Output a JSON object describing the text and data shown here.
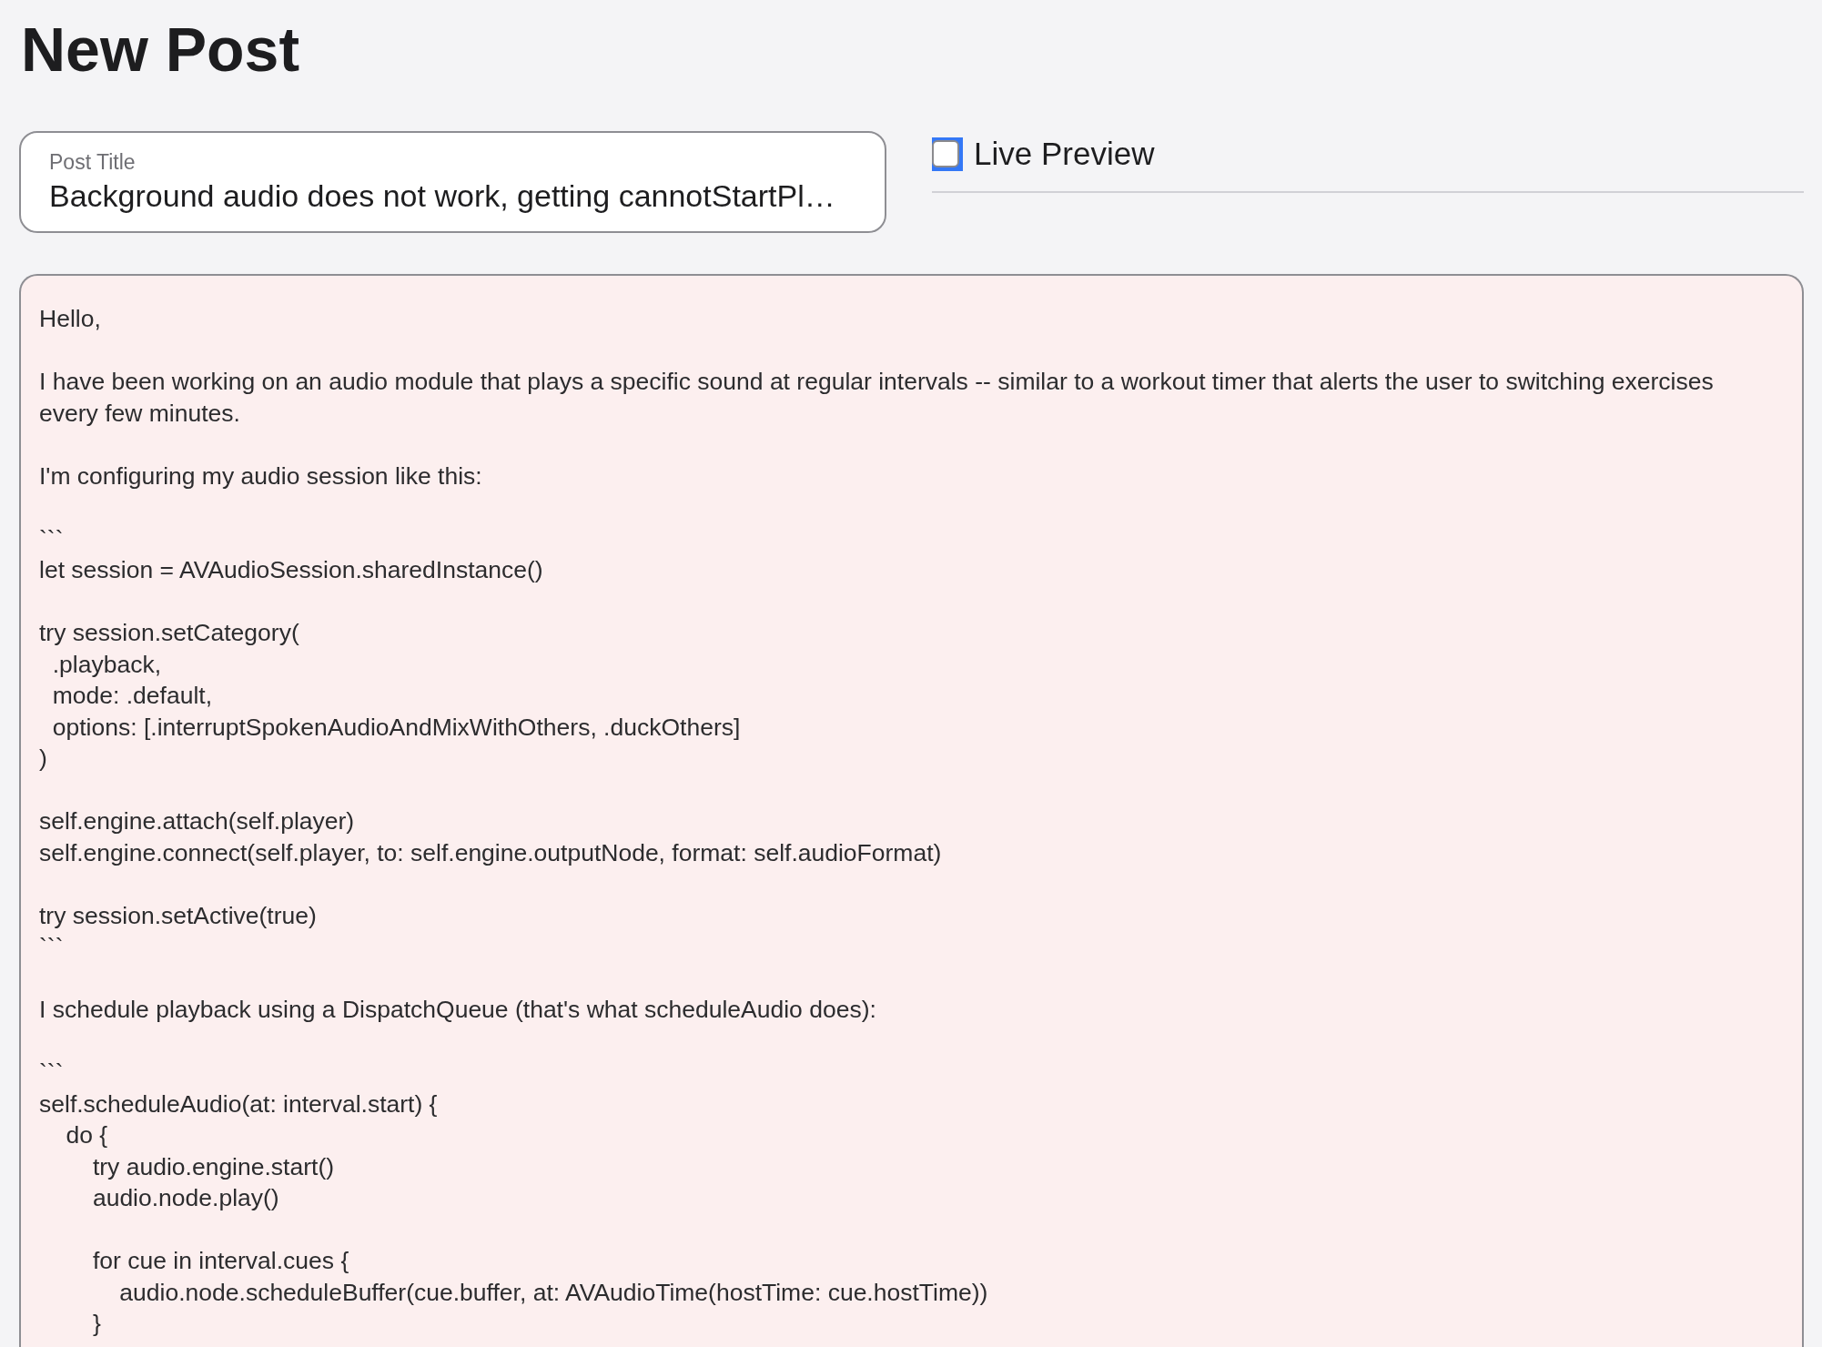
{
  "page": {
    "title": "New Post"
  },
  "title_field": {
    "label": "Post Title",
    "value": "Background audio does not work, getting cannotStartPl…"
  },
  "live_preview": {
    "label": "Live Preview",
    "checked": false
  },
  "body_field": {
    "value": "Hello,\n\nI have been working on an audio module that plays a specific sound at regular intervals -- similar to a workout timer that alerts the user to switching exercises every few minutes.\n\nI'm configuring my audio session like this:\n\n```\nlet session = AVAudioSession.sharedInstance()\n\ntry session.setCategory(\n  .playback,\n  mode: .default,\n  options: [.interruptSpokenAudioAndMixWithOthers, .duckOthers]\n)\n\nself.engine.attach(self.player)\nself.engine.connect(self.player, to: self.engine.outputNode, format: self.audioFormat)\n\ntry session.setActive(true)\n```\n\nI schedule playback using a DispatchQueue (that's what scheduleAudio does):\n\n```\nself.scheduleAudio(at: interval.start) {\n    do {\n        try audio.engine.start()\n        audio.node.play()\n\n        for cue in interval.cues {\n            audio.node.scheduleBuffer(cue.buffer, at: AVAudioTime(hostTime: cue.hostTime))\n        }"
  }
}
